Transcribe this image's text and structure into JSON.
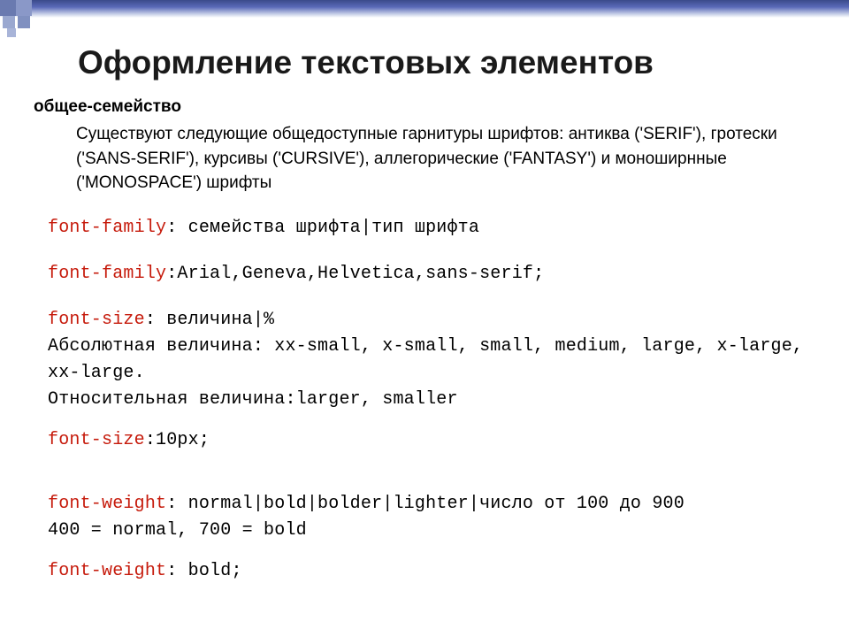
{
  "title": "Оформление текстовых элементов",
  "section_label": "общее-семейство",
  "body_paragraph": "Существуют следующие общедоступные гарнитуры шрифтов: антиква ('SERIF'), гротески ('SANS-SERIF'), курсивы ('CURSIVE'), аллегорические ('FANTASY') и моноширнные ('MONOSPACE') шрифты",
  "code": {
    "l1_prop": "font-family",
    "l1_val": ": семейства шрифта|тип шрифта",
    "l2_prop": "font-family",
    "l2_val": ":Arial,Geneva,Helvetica,sans-serif;",
    "l3_prop": "font-size",
    "l3_val": ": величина|%",
    "l4": "Абсолютная величина: xx-small, x-small, small, medium, large, x-large, xx-large.",
    "l5": "Относительная величина:larger, smaller",
    "l6_prop": "font-size",
    "l6_val": ":10px;",
    "l7_prop": "font-weight",
    "l7_val": ": normal|bold|bolder|lighter|число от 100 до 900",
    "l8": "400 = normal, 700 = bold",
    "l9_prop": "font-weight",
    "l9_val": ": bold;"
  }
}
